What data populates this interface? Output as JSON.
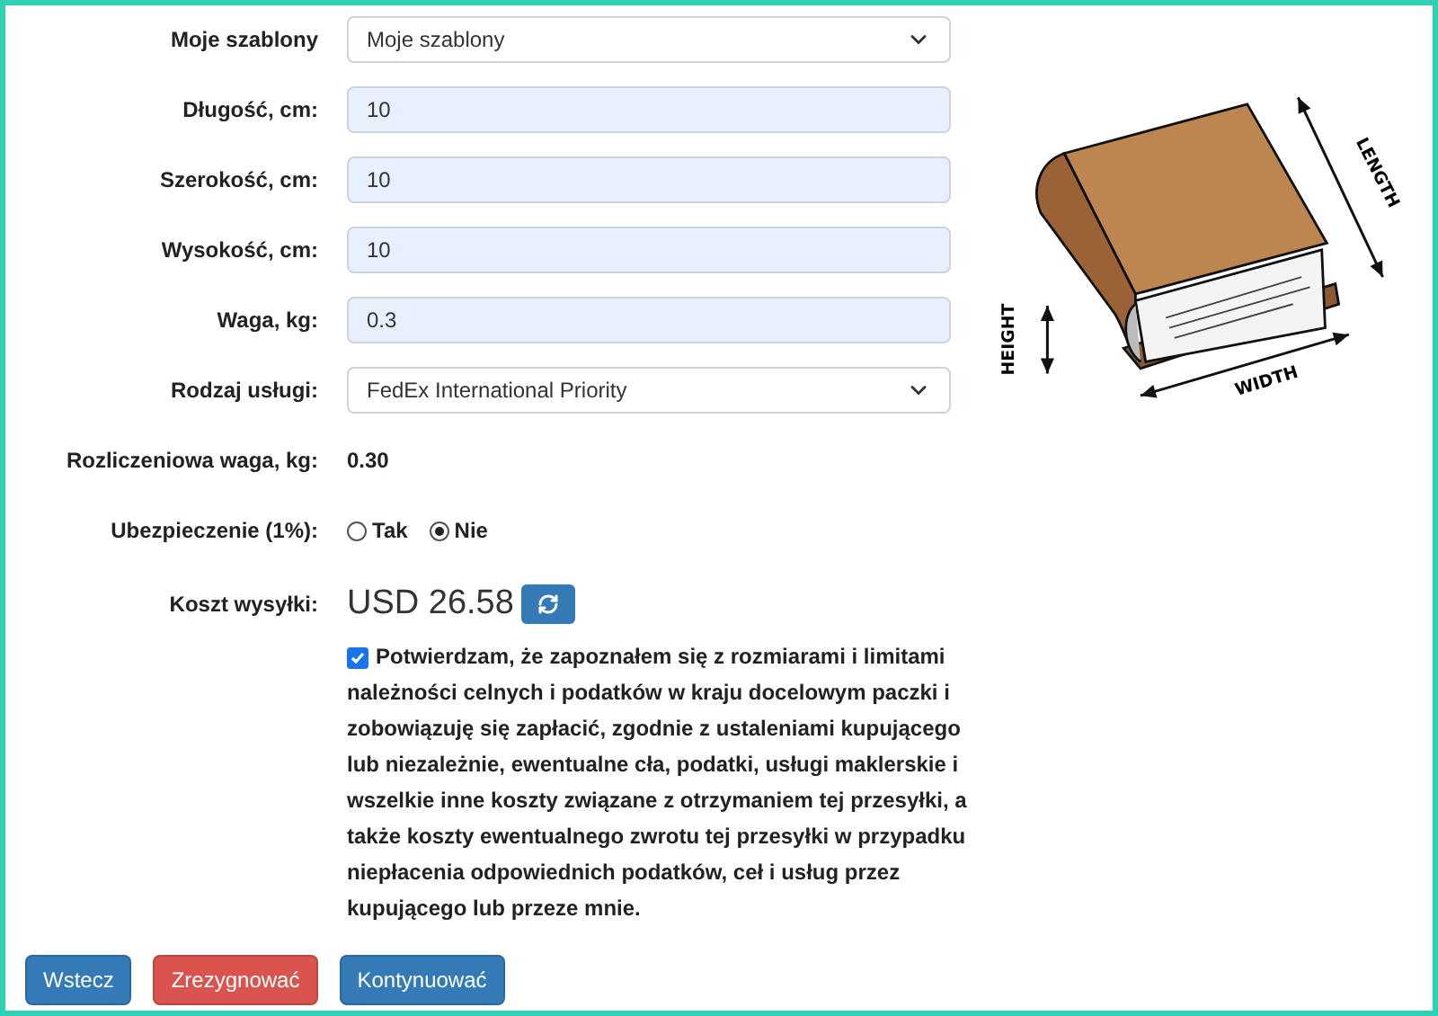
{
  "fields": [
    {
      "label": "Moje szablony",
      "kind": "select",
      "value": "Moje szablony"
    },
    {
      "label": "Długość, cm:",
      "kind": "input",
      "value": "10"
    },
    {
      "label": "Szerokość, cm:",
      "kind": "input",
      "value": "10"
    },
    {
      "label": "Wysokość, cm:",
      "kind": "input",
      "value": "10"
    },
    {
      "label": "Waga, kg:",
      "kind": "input",
      "value": "0.3"
    },
    {
      "label": "Rodzaj usługi:",
      "kind": "select",
      "value": "FedEx International Priority"
    }
  ],
  "billable": {
    "label": "Rozliczeniowa waga, kg:",
    "value": "0.30"
  },
  "insurance": {
    "label": "Ubezpieczenie (1%):",
    "options": [
      {
        "label": "Tak",
        "selected": false
      },
      {
        "label": "Nie",
        "selected": true
      }
    ]
  },
  "cost": {
    "label": "Koszt wysyłki:",
    "value": "USD 26.58"
  },
  "consent": {
    "checked": true,
    "text": "Potwierdzam, że zapoznałem się z rozmiarami i limitami należności celnych i podatków w kraju docelowym paczki i zobowiązuję się zapłacić, zgodnie z ustaleniami kupującego lub niezależnie, ewentualne cła, podatki, usługi maklerskie i wszelkie inne koszty związane z otrzymaniem tej przesyłki, a także koszty ewentualnego zwrotu tej przesyłki w przypadku niepłacenia odpowiednich podatków, ceł i usług przez kupującego lub przeze mnie."
  },
  "illustration": {
    "length": "LENGTH",
    "height": "HEIGHT",
    "width": "WIDTH"
  },
  "buttons": [
    {
      "label": "Wstecz",
      "kind": "primary"
    },
    {
      "label": "Zrezygnować",
      "kind": "danger"
    },
    {
      "label": "Kontynuować",
      "kind": "primary"
    }
  ]
}
